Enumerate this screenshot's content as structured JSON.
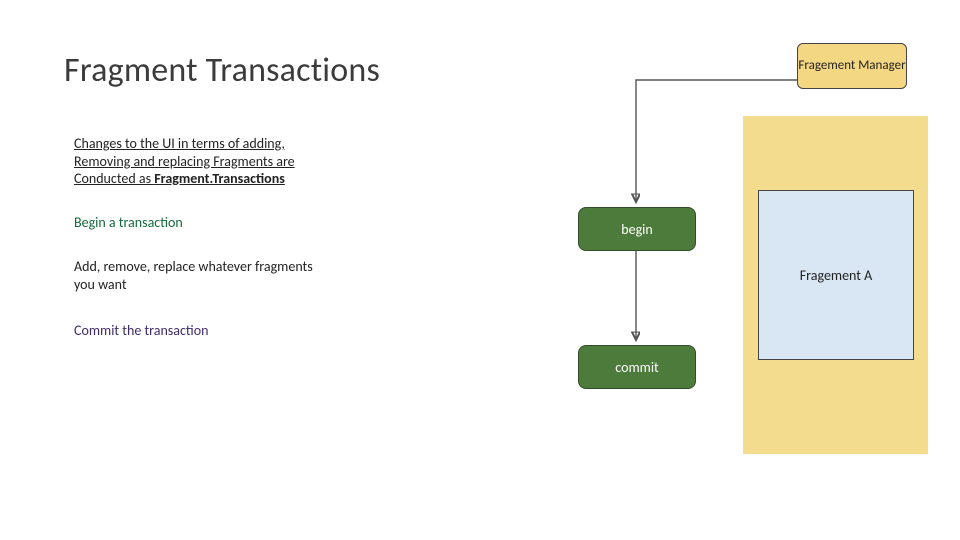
{
  "slide": {
    "title": "Fragment Transactions",
    "description": {
      "line1": "Changes to the UI in terms of adding,",
      "line2": "Removing and replacing Fragments are",
      "line3_prefix": "Conducted as ",
      "line3_bold": "Fragment.Transactions"
    },
    "steps": {
      "begin": "Begin a transaction",
      "modify_l1": "Add, remove, replace whatever fragments",
      "modify_l2": "you want",
      "commit": "Commit the transaction"
    },
    "diagram": {
      "manager_label": "Fragement Manager",
      "fragment_label": "Fragement A",
      "begin_node": "begin",
      "commit_node": "commit"
    }
  },
  "colors": {
    "yellow": "#f4dc8f",
    "yellow_dark": "#f4d782",
    "green": "#4d7b3c",
    "blue": "#d9e6f3",
    "text_green": "#14693a",
    "text_purple": "#3f2a6a"
  }
}
